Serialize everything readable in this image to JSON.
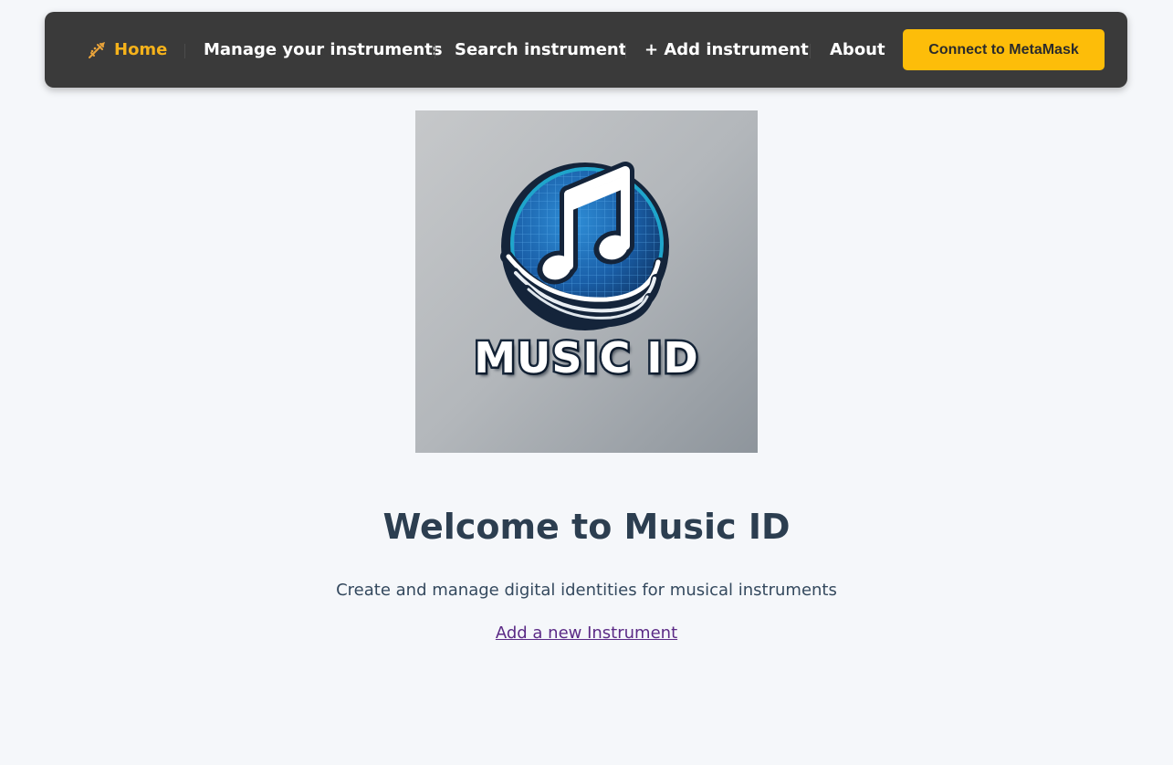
{
  "nav": {
    "home_label": "Home",
    "home_icon": "trumpet-icon",
    "manage_label": "Manage your instruments",
    "search_label": "Search instrument",
    "add_label": "+ Add instrument",
    "about_label": "About",
    "connect_label": "Connect to MetaMask"
  },
  "logo": {
    "text": "MUSIC ID",
    "icon": "music-note-icon"
  },
  "hero": {
    "title": "Welcome to Music ID",
    "subtitle": "Create and manage digital identities for musical instruments",
    "link_label": "Add a new Instrument"
  },
  "colors": {
    "nav_bg": "#3a3a3a",
    "accent": "#f5b21b",
    "button": "#fdbd09",
    "title": "#2c3e50",
    "link": "#5b2a86",
    "background": "#f5f7fa"
  }
}
